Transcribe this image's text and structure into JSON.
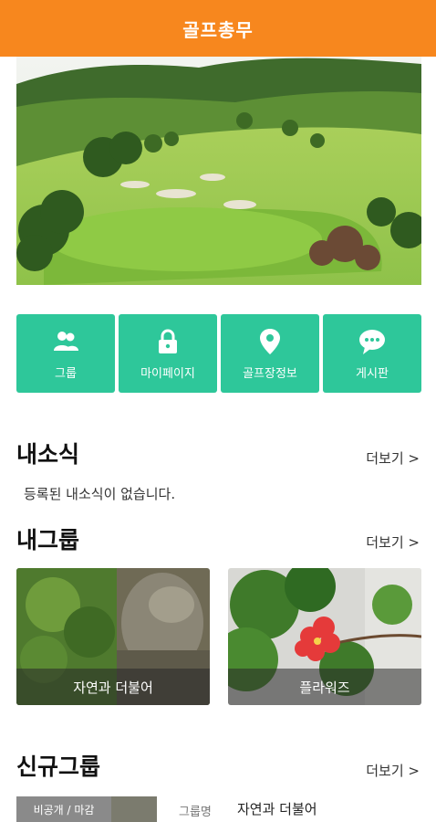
{
  "app": {
    "title": "골프총무"
  },
  "menu": [
    {
      "label": "그룹",
      "icon": "group-icon"
    },
    {
      "label": "마이페이지",
      "icon": "lock-icon"
    },
    {
      "label": "골프장정보",
      "icon": "location-pin-icon"
    },
    {
      "label": "게시판",
      "icon": "chat-bubble-icon"
    }
  ],
  "my_news": {
    "title": "내소식",
    "more": "더보기 >",
    "empty": "등록된 내소식이 없습니다."
  },
  "my_groups": {
    "title": "내그룹",
    "more": "더보기 >",
    "cards": [
      {
        "name": "자연과 더불어"
      },
      {
        "name": "플라워즈"
      }
    ]
  },
  "new_groups": {
    "title": "신규그룹",
    "more": "더보기 >",
    "items": [
      {
        "badge": "비공개 / 마감",
        "key": "그룹명",
        "value": "자연과 더불어"
      }
    ]
  },
  "colors": {
    "appbar": "#f7871e",
    "tile": "#2ec79a"
  }
}
